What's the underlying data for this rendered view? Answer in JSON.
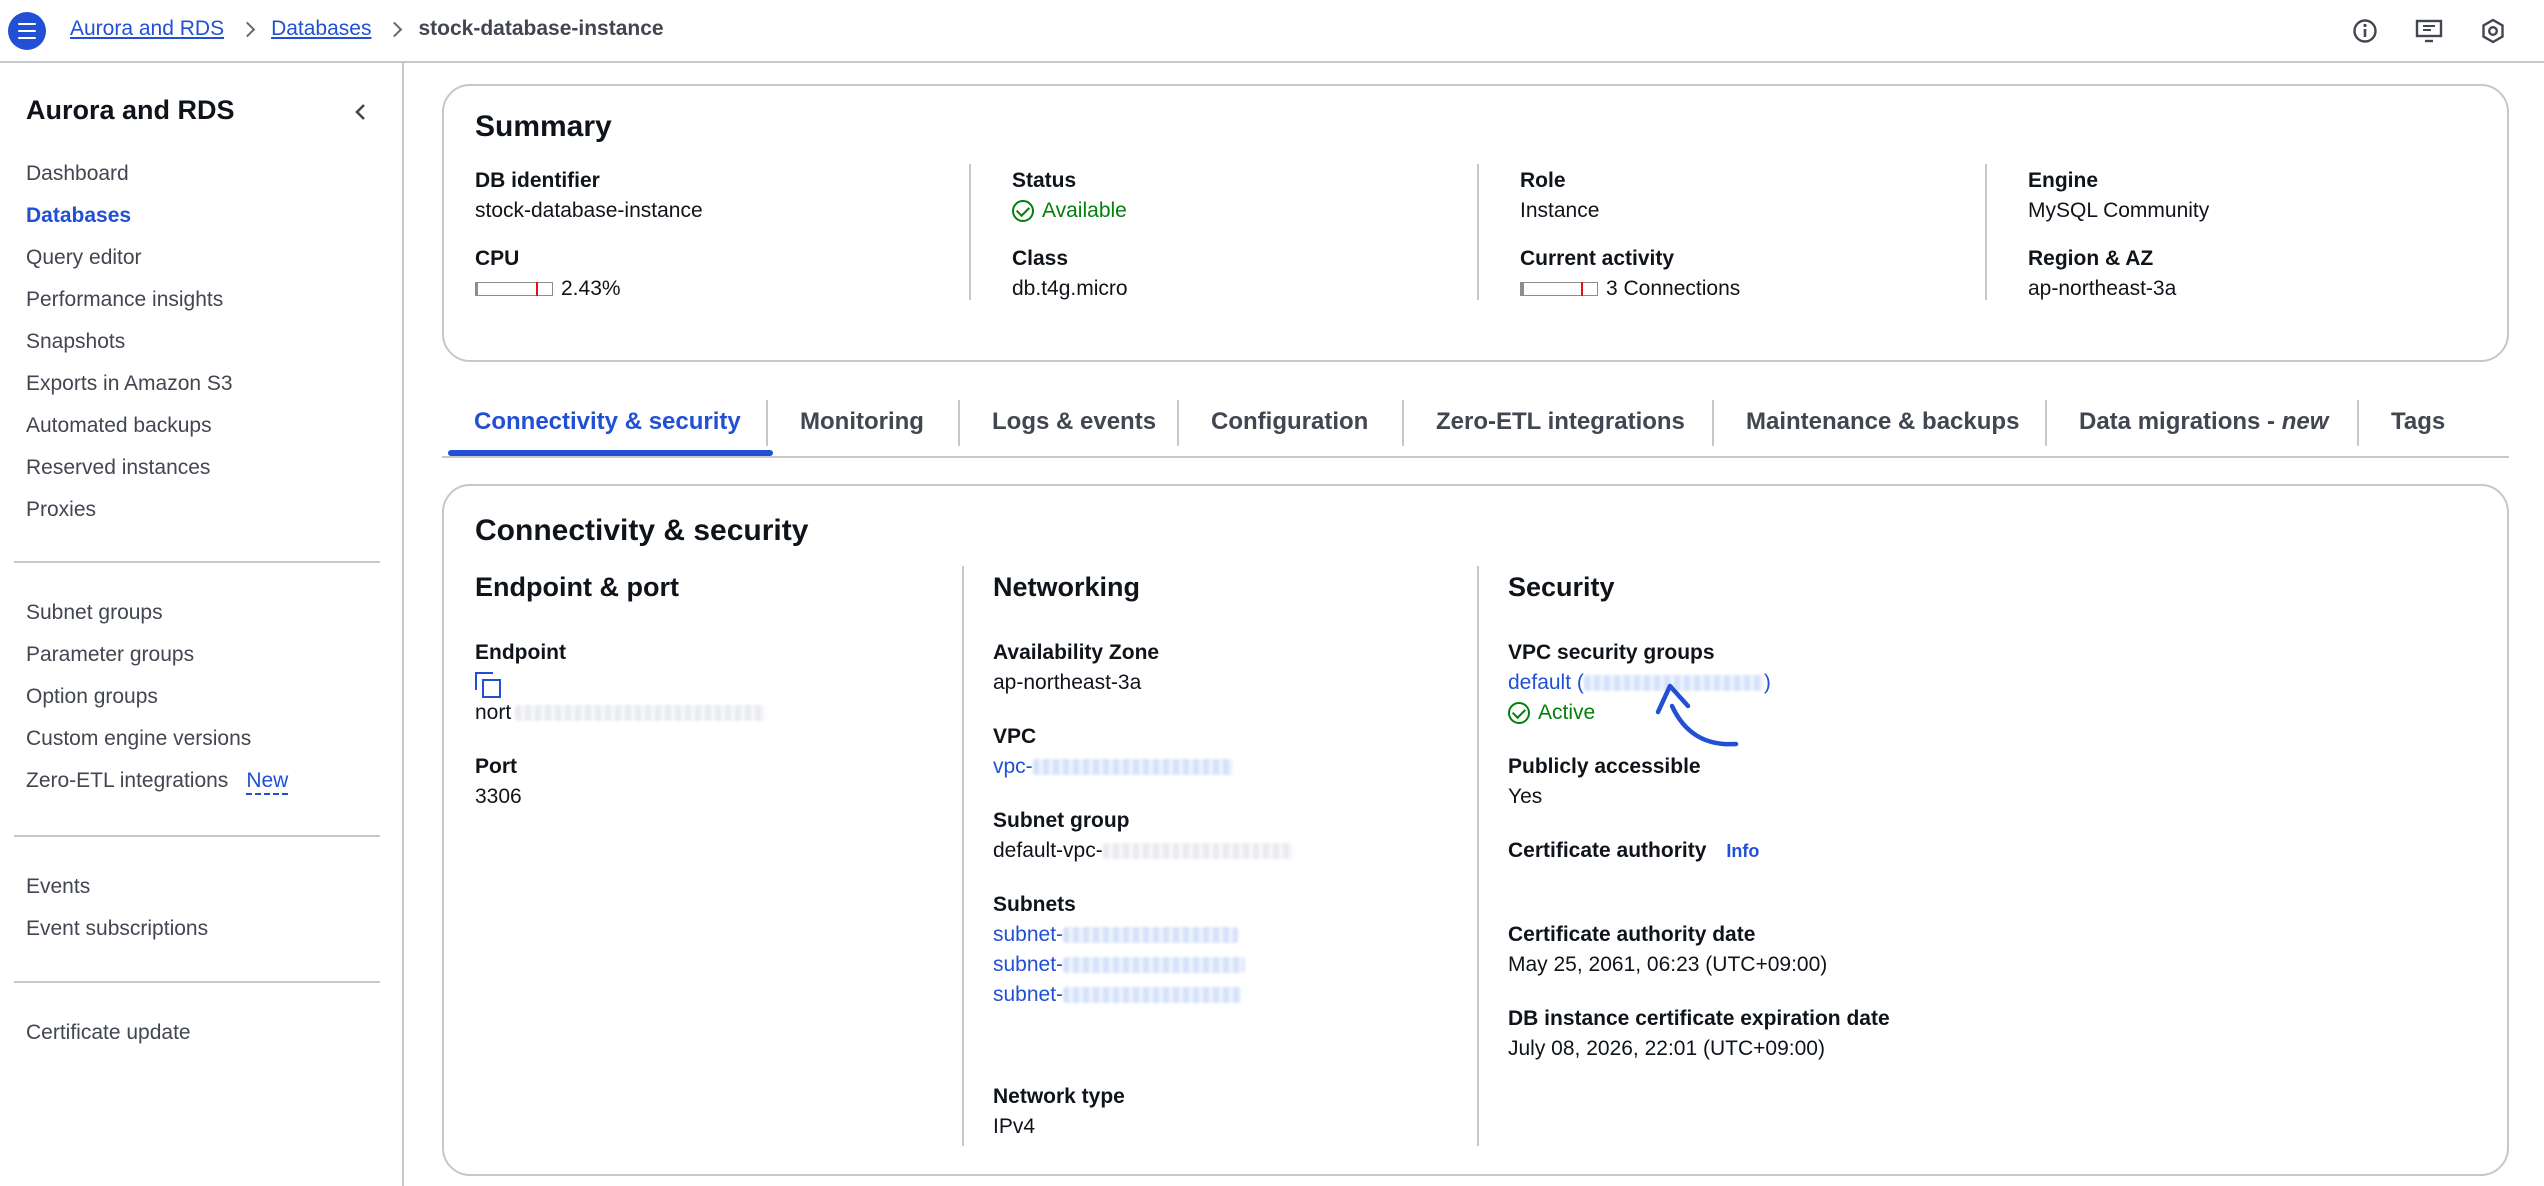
{
  "breadcrumb": {
    "items": [
      "Aurora and RDS",
      "Databases"
    ],
    "current": "stock-database-instance"
  },
  "topbar": {
    "icons": [
      "info-icon",
      "feedback-icon",
      "settings-icon"
    ]
  },
  "sidebar": {
    "title": "Aurora and RDS",
    "group1": [
      "Dashboard",
      "Databases",
      "Query editor",
      "Performance insights",
      "Snapshots",
      "Exports in Amazon S3",
      "Automated backups",
      "Reserved instances",
      "Proxies"
    ],
    "group2": [
      "Subnet groups",
      "Parameter groups",
      "Option groups",
      "Custom engine versions",
      "Zero-ETL integrations"
    ],
    "new_badge": "New",
    "group3": [
      "Events",
      "Event subscriptions"
    ],
    "group4": [
      "Certificate update"
    ]
  },
  "summary": {
    "title": "Summary",
    "db_identifier_label": "DB identifier",
    "db_identifier": "stock-database-instance",
    "cpu_label": "CPU",
    "cpu_value": "2.43%",
    "cpu_fraction": 0.0243,
    "status_label": "Status",
    "status": "Available",
    "class_label": "Class",
    "class": "db.t4g.micro",
    "role_label": "Role",
    "role": "Instance",
    "activity_label": "Current activity",
    "activity": "3 Connections",
    "engine_label": "Engine",
    "engine": "MySQL Community",
    "region_label": "Region & AZ",
    "region": "ap-northeast-3a"
  },
  "tabs": [
    "Connectivity & security",
    "Monitoring",
    "Logs & events",
    "Configuration",
    "Zero-ETL integrations",
    "Maintenance & backups",
    "Data migrations - ",
    "Tags"
  ],
  "tab_new": "new",
  "connectivity": {
    "title": "Connectivity & security",
    "endpoint_section": "Endpoint & port",
    "endpoint_label": "Endpoint",
    "endpoint_prefix": "nort",
    "port_label": "Port",
    "port": "3306",
    "networking_section": "Networking",
    "az_label": "Availability Zone",
    "az": "ap-northeast-3a",
    "vpc_label": "VPC",
    "vpc_prefix": "vpc-",
    "subnet_group_label": "Subnet group",
    "subnet_group_prefix": "default-vpc-",
    "subnets_label": "Subnets",
    "subnet_prefix": "subnet-",
    "network_type_label": "Network type",
    "network_type": "IPv4",
    "security_section": "Security",
    "vpc_sg_label": "VPC security groups",
    "vpc_sg_prefix": "default (",
    "vpc_sg_suffix": ")",
    "vpc_sg_status": "Active",
    "public_label": "Publicly accessible",
    "public": "Yes",
    "ca_label": "Certificate authority",
    "ca_info": "Info",
    "ca_date_label": "Certificate authority date",
    "ca_date": "May 25, 2061, 06:23 (UTC+09:00)",
    "cert_exp_label": "DB instance certificate expiration date",
    "cert_exp": "July 08, 2026, 22:01 (UTC+09:00)"
  },
  "colors": {
    "accent": "#2150d5",
    "success": "#037f0c",
    "border": "#c6c6cd"
  }
}
